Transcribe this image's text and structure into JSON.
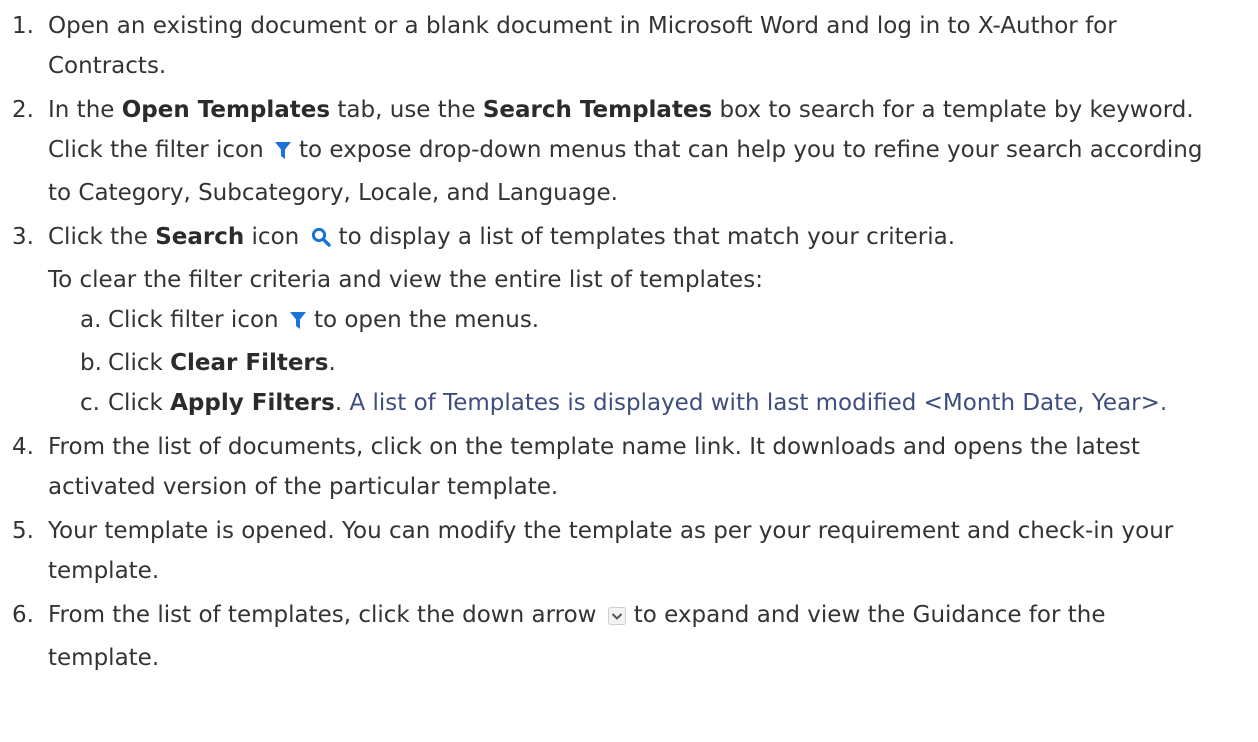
{
  "steps": [
    {
      "num": "1.",
      "text": "Open an existing document or a blank document in Microsoft Word and log in to X-Author for Contracts."
    },
    {
      "num": "2.",
      "p1": "In the ",
      "b1": "Open Templates",
      "p2": " tab, use the ",
      "b2": "Search Templates",
      "p3": " box to search for a template by keyword. Click the filter icon",
      "p4": "to expose drop-down menus that can help you to refine your search according to Category, Subcategory, Locale, and Language."
    },
    {
      "num": "3.",
      "p1": "Click the ",
      "b1": "Search",
      "p2": " icon",
      "p3": "to display a list of templates that match your criteria.",
      "p4": "To clear the filter criteria and view the entire list of templates:",
      "sub": [
        {
          "letter": "a.",
          "p1": "Click filter icon",
          "p2": "to open the menus."
        },
        {
          "letter": "b.",
          "p1": "Click ",
          "b1": "Clear Filters",
          "p2": "."
        },
        {
          "letter": "c.",
          "p1": "Click ",
          "b1": "Apply Filters",
          "p2": ". ",
          "link": "A list of Templates is displayed with last modified <Month Date, Year>."
        }
      ]
    },
    {
      "num": "4.",
      "text": "From the list of documents, click on the template name link. It downloads and opens the latest activated version of the particular template."
    },
    {
      "num": "5.",
      "text": "Your template is opened. You can modify the template as per your requirement and check-in your template."
    },
    {
      "num": "6.",
      "p1": "From the list of templates, click the down arrow",
      "p2": "to expand and view the Guidance for the template."
    }
  ],
  "icons": {
    "filter": "filter-icon",
    "search": "search-icon",
    "down_arrow": "chevron-down-icon"
  },
  "colors": {
    "text": "#333333",
    "link": "#3d4e7e",
    "icon_blue": "#1a73d9"
  }
}
